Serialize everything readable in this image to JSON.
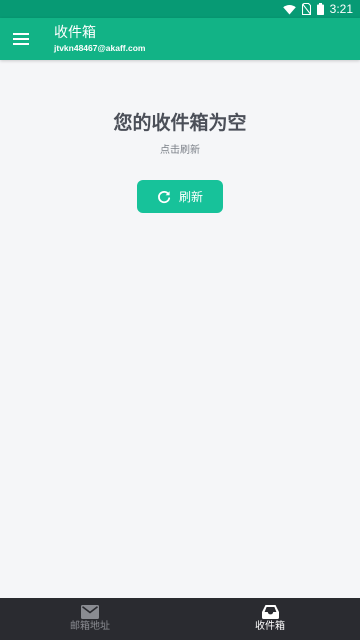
{
  "status_bar": {
    "time": "3:21",
    "icons": [
      "wifi-icon",
      "no-sim-icon",
      "battery-icon"
    ]
  },
  "app_bar": {
    "title": "收件箱",
    "email": "jtvkn48467@akaff.com",
    "menu_icon": "hamburger-menu-icon"
  },
  "empty_state": {
    "title": "您的收件箱为空",
    "hint": "点击刷新",
    "refresh_label": "刷新",
    "refresh_icon": "refresh-icon"
  },
  "bottom_nav": {
    "items": [
      {
        "label": "邮箱地址",
        "icon": "mail-icon",
        "active": false
      },
      {
        "label": "收件箱",
        "icon": "inbox-icon",
        "active": true
      }
    ]
  },
  "colors": {
    "status_bar": "#079a74",
    "app_bar": "#12b386",
    "accent_button": "#17c29a",
    "background": "#f5f6f8",
    "bottom_nav": "#2a2b30"
  }
}
